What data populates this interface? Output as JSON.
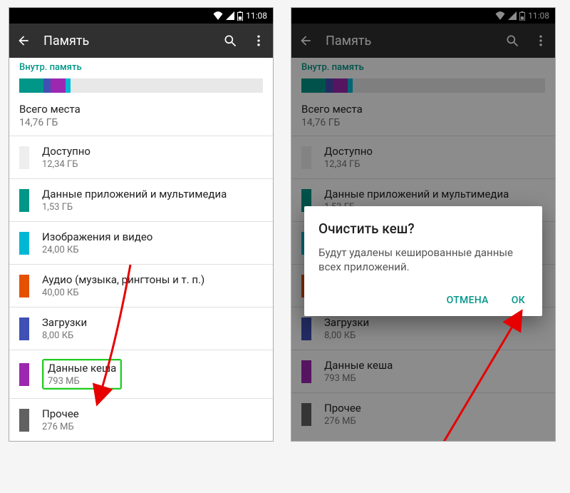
{
  "statusbar": {
    "time": "11:08"
  },
  "appbar": {
    "title": "Память"
  },
  "section_label": "Внутр. память",
  "storage_segments": [
    {
      "color": "#009688",
      "pct": 10
    },
    {
      "color": "#3f51b5",
      "pct": 3
    },
    {
      "color": "#9c27b0",
      "pct": 6
    },
    {
      "color": "#00b8d4",
      "pct": 2
    },
    {
      "color": "#e8e8e8",
      "pct": 79
    }
  ],
  "total": {
    "label": "Всего места",
    "value": "14,76 ГБ"
  },
  "rows": [
    {
      "color": "#eeeeee",
      "label": "Доступно",
      "value": "12,34 ГБ"
    },
    {
      "color": "#009688",
      "label": "Данные приложений и мультимедиа",
      "value": "1,53 ГБ"
    },
    {
      "color": "#00b8d4",
      "label": "Изображения и видео",
      "value": "24,00 КБ"
    },
    {
      "color": "#e65100",
      "label": "Аудио (музыка, рингтоны и т. п.)",
      "value": "40,00 КБ"
    },
    {
      "color": "#3f51b5",
      "label": "Загрузки",
      "value": "8,00 КБ"
    },
    {
      "color": "#9c27b0",
      "label": "Данные кеша",
      "value": "793 МБ",
      "highlight": true
    },
    {
      "color": "#616161",
      "label": "Прочее",
      "value": "276 МБ"
    }
  ],
  "dialog": {
    "title": "Очистить кеш?",
    "message": "Будут удалены кешированные данные всех приложений.",
    "cancel": "ОТМЕНА",
    "ok": "ОК"
  }
}
